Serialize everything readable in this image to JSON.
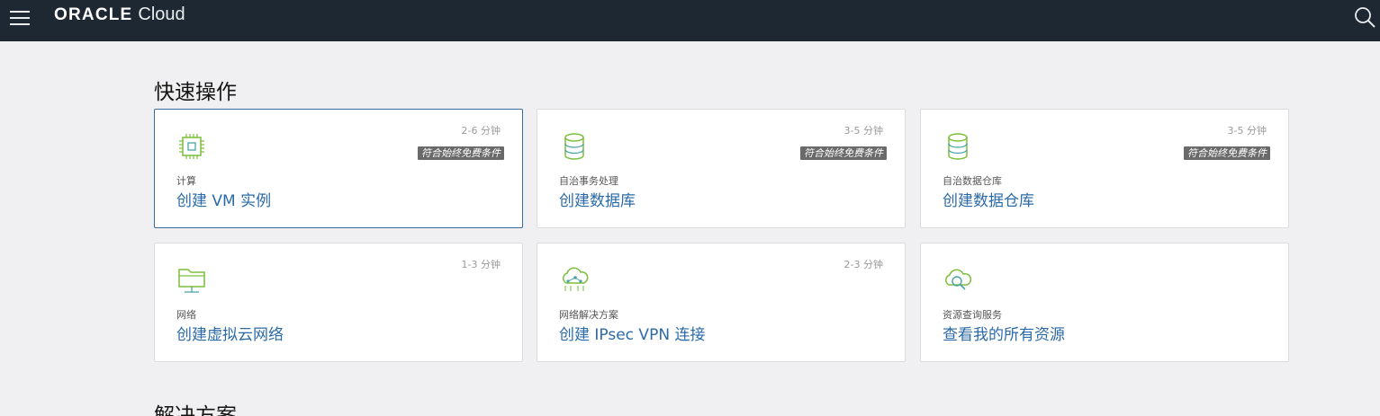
{
  "header": {
    "brand_oracle": "ORACLE",
    "brand_cloud": "Cloud",
    "menu_icon": "hamburger-menu-icon",
    "search_icon": "search-icon",
    "background_color": "#1e2833"
  },
  "quick_actions": {
    "title": "快速操作",
    "cards": [
      {
        "time": "2-6 分钟",
        "badge": "符合始终免费条件",
        "category": "计算",
        "action": "创建 VM 实例",
        "icon": "compute-chip-icon",
        "active": true
      },
      {
        "time": "3-5 分钟",
        "badge": "符合始终免费条件",
        "category": "自治事务处理",
        "action": "创建数据库",
        "icon": "database-icon",
        "active": false
      },
      {
        "time": "3-5 分钟",
        "badge": "符合始终免费条件",
        "category": "自治数据仓库",
        "action": "创建数据仓库",
        "icon": "database-icon",
        "active": false
      },
      {
        "time": "1-3 分钟",
        "badge": "",
        "category": "网络",
        "action": "创建虚拟云网络",
        "icon": "network-folder-icon",
        "active": false
      },
      {
        "time": "2-3 分钟",
        "badge": "",
        "category": "网络解决方案",
        "action": "创建 IPsec VPN 连接",
        "icon": "cloud-network-icon",
        "active": false
      },
      {
        "time": "",
        "badge": "",
        "category": "资源查询服务",
        "action": "查看我的所有资源",
        "icon": "cloud-search-icon",
        "active": false
      }
    ]
  },
  "solutions": {
    "title": "解决方案"
  },
  "colors": {
    "link": "#2b6aa8",
    "icon_green": "#7bbf3b",
    "icon_teal": "#4aa3a6",
    "badge_bg": "#6a6a6a"
  }
}
